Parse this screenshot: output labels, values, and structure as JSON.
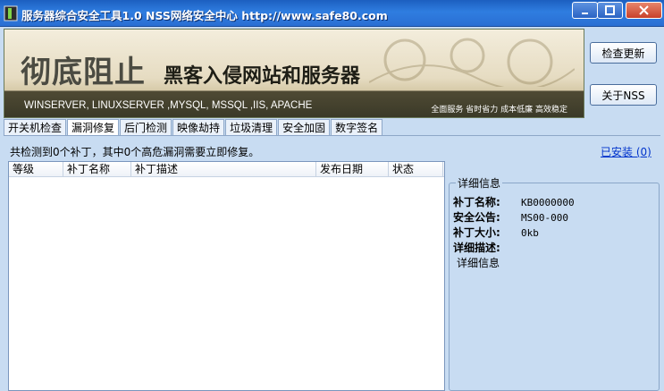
{
  "window": {
    "title": "服务器综合安全工具1.0  NSS网络安全中心  http://www.safe80.com"
  },
  "banner": {
    "slogan_big": "彻底阻止",
    "slogan_small": "黑客入侵网站和服务器",
    "platforms": "WINSERVER, LINUXSERVER ,MYSQL, MSSQL ,IIS, APACHE",
    "tagline": "全面服务 省时省力 成本低廉 高效稳定"
  },
  "buttons": {
    "check_update": "检查更新",
    "about": "关于NSS"
  },
  "tabs": [
    {
      "label": "开关机检查"
    },
    {
      "label": "漏洞修复"
    },
    {
      "label": "后门检测"
    },
    {
      "label": "映像劫持"
    },
    {
      "label": "垃圾清理"
    },
    {
      "label": "安全加固"
    },
    {
      "label": "数字签名"
    }
  ],
  "active_tab": "漏洞修复",
  "main": {
    "summary": "共检测到0个补丁，其中0个高危漏洞需要立即修复。",
    "installed_link": "已安装 (0)",
    "columns": [
      "等级",
      "补丁名称",
      "补丁描述",
      "发布日期",
      "状态"
    ]
  },
  "details": {
    "title": "详细信息",
    "patch_name_label": "补丁名称:",
    "patch_name_value": "KB0000000",
    "bulletin_label": "安全公告:",
    "bulletin_value": "MS00-000",
    "size_label": "补丁大小:",
    "size_value": "0kb",
    "desc_label": "详细描述:",
    "desc_value": "详细信息"
  },
  "colors": {
    "titlebar": "#2a6fd3",
    "window_bg": "#c8dcf2",
    "link": "#0033cc"
  }
}
